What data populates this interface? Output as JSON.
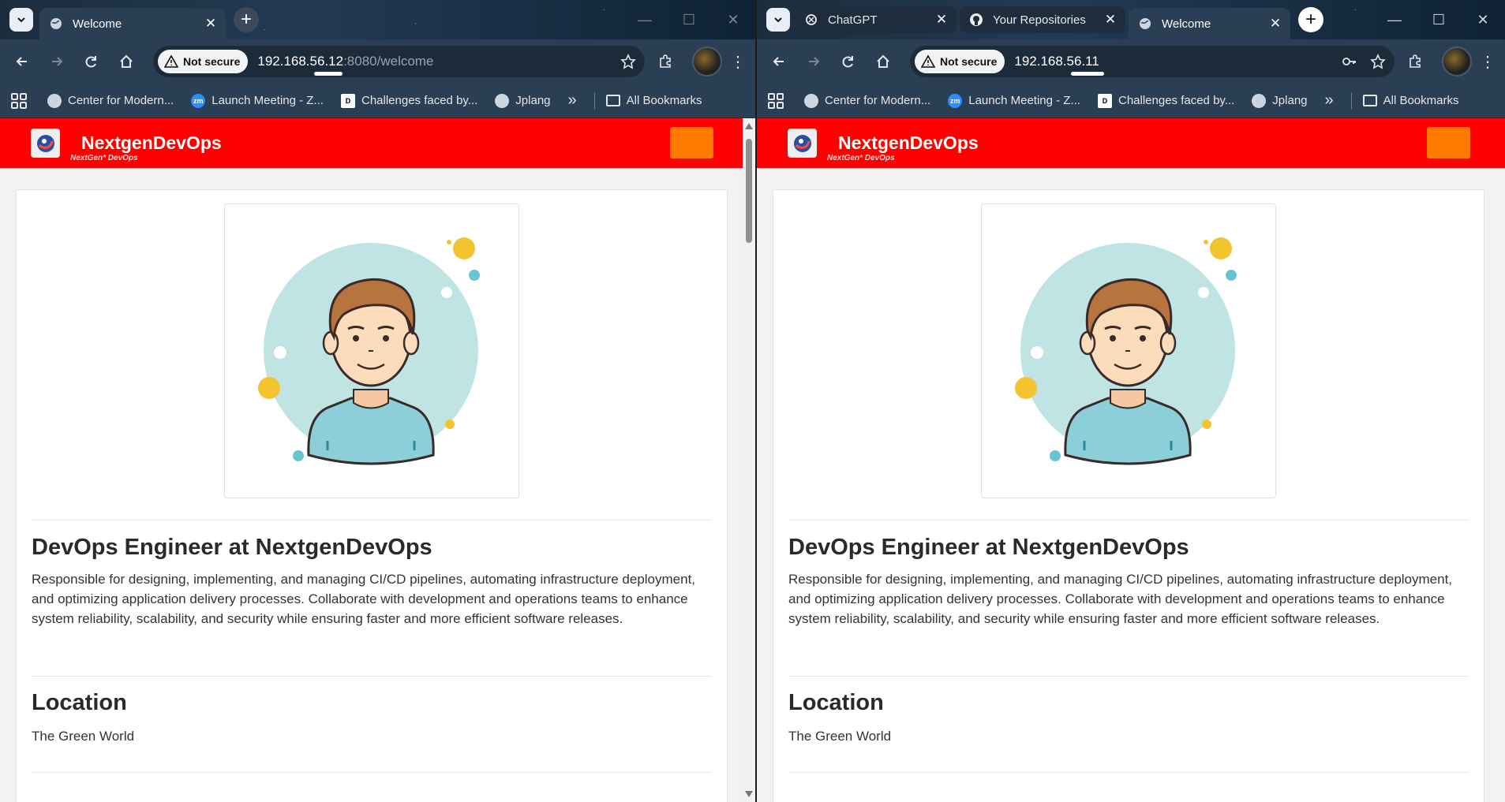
{
  "left_window": {
    "tabs": [
      {
        "title": "Welcome",
        "icon": "globe-icon",
        "active": true
      }
    ],
    "address": {
      "security_label": "Not secure",
      "url_host": "192.168.56.12",
      "url_rest": ":8080/welcome"
    }
  },
  "right_window": {
    "tabs": [
      {
        "title": "ChatGPT",
        "icon": "chatgpt-icon",
        "active": false
      },
      {
        "title": "Your Repositories",
        "icon": "github-icon",
        "active": false
      },
      {
        "title": "Welcome",
        "icon": "globe-icon",
        "active": true
      }
    ],
    "address": {
      "security_label": "Not secure",
      "url_host": "192.168.56.11",
      "url_rest": ""
    }
  },
  "bookmarks": [
    {
      "label": "Center for Modern...",
      "icon": "globe-icon"
    },
    {
      "label": "Launch Meeting - Z...",
      "icon": "zoom-icon"
    },
    {
      "label": "Challenges faced by...",
      "icon": "dev-icon"
    },
    {
      "label": "Jplang",
      "icon": "globe-icon"
    }
  ],
  "bookmarks_overflow": "»",
  "all_bookmarks_label": "All Bookmarks",
  "page": {
    "brand": "NextgenDevOps",
    "brand_tagline": "NextGen* DevOps",
    "job_title": "DevOps Engineer at NextgenDevOps",
    "job_description": "Responsible for designing, implementing, and managing CI/CD pipelines, automating infrastructure deployment, and optimizing application delivery processes. Collaborate with development and operations teams to enhance system reliability, scalability, and security while ensuring faster and more efficient software releases.",
    "location_heading": "Location",
    "location_value": "The Green World"
  },
  "colors": {
    "header_red": "#ff0000",
    "menu_orange": "#ff7a00",
    "chrome_toolbar": "#2b3f54"
  }
}
